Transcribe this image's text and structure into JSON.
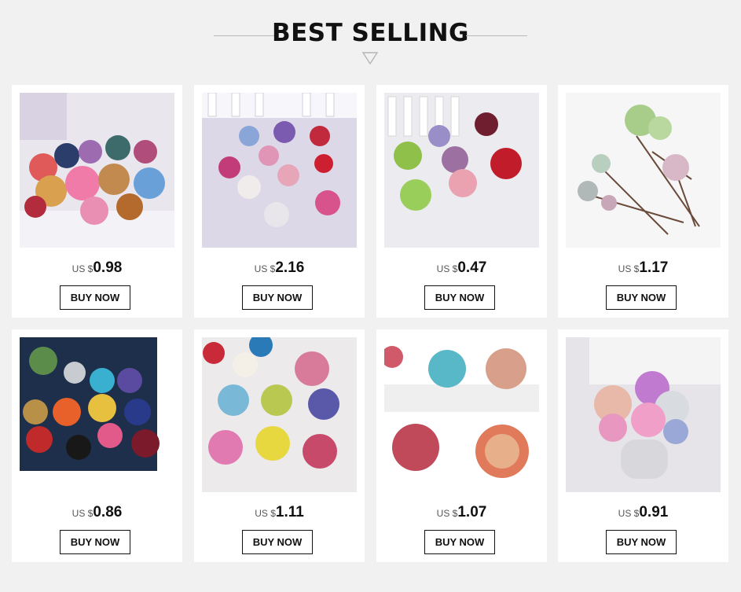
{
  "section": {
    "title": "BEST SELLING"
  },
  "currency_prefix": "US $",
  "products": [
    {
      "price": "0.98",
      "button": "BUY NOW"
    },
    {
      "price": "2.16",
      "button": "BUY NOW"
    },
    {
      "price": "0.47",
      "button": "BUY NOW"
    },
    {
      "price": "1.17",
      "button": "BUY NOW"
    },
    {
      "price": "0.86",
      "button": "BUY NOW"
    },
    {
      "price": "1.11",
      "button": "BUY NOW"
    },
    {
      "price": "1.07",
      "button": "BUY NOW"
    },
    {
      "price": "0.91",
      "button": "BUY NOW"
    }
  ],
  "colors": {
    "background": "#f1f1f1",
    "card": "#ffffff",
    "text": "#111111",
    "divider": "#b9b9b9"
  }
}
